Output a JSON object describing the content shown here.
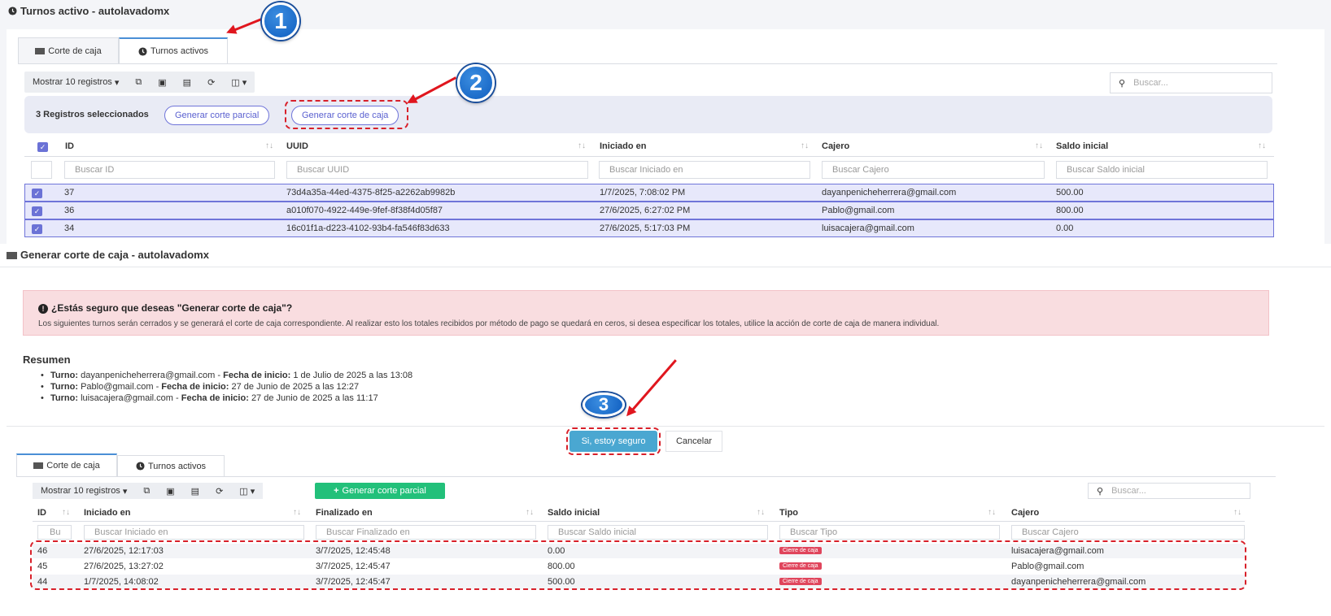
{
  "panel1": {
    "title": "Turnos activo - autolavadomx",
    "tabs": [
      "Corte de caja",
      "Turnos activos"
    ],
    "show_records": "Mostrar 10 registros",
    "search_placeholder": "Buscar...",
    "selected_text": "3 Registros seleccionados",
    "btn_partial": "Generar corte parcial",
    "btn_cut": "Generar corte de caja",
    "columns": [
      "ID",
      "UUID",
      "Iniciado en",
      "Cajero",
      "Saldo inicial"
    ],
    "filters": [
      "Buscar ID",
      "Buscar UUID",
      "Buscar Iniciado en",
      "Buscar Cajero",
      "Buscar Saldo inicial"
    ],
    "rows": [
      [
        "37",
        "73d4a35a-44ed-4375-8f25-a2262ab9982b",
        "1/7/2025, 7:08:02 PM",
        "dayanpenicheherrera@gmail.com",
        "500.00"
      ],
      [
        "36",
        "a010f070-4922-449e-9fef-8f38f4d05f87",
        "27/6/2025, 6:27:02 PM",
        "Pablo@gmail.com",
        "800.00"
      ],
      [
        "34",
        "16c01f1a-d223-4102-93b4-fa546f83d633",
        "27/6/2025, 5:17:03 PM",
        "luisacajera@gmail.com",
        "0.00"
      ]
    ]
  },
  "panel2": {
    "title": "Generar corte de caja - autolavadomx",
    "alert_title": "¿Estás seguro que deseas \"Generar corte de caja\"?",
    "alert_body": "Los siguientes turnos serán cerrados y se generará el corte de caja correspondiente. Al realizar esto los totales recibidos por método de pago se quedará en ceros, si desea especificar los totales, utilice la acción de corte de caja de manera individual.",
    "summary_title": "Resumen",
    "label_turno": "Turno:",
    "label_fecha": "Fecha de inicio:",
    "items": [
      {
        "turno": "dayanpenicheherrera@gmail.com",
        "fecha": "1 de Julio de 2025 a las 13:08"
      },
      {
        "turno": "Pablo@gmail.com",
        "fecha": "27 de Junio de 2025 a las 12:27"
      },
      {
        "turno": "luisacajera@gmail.com",
        "fecha": "27 de Junio de 2025 a las 11:17"
      }
    ],
    "confirm": "Si, estoy seguro",
    "cancel": "Cancelar"
  },
  "panel3": {
    "tabs": [
      "Corte de caja",
      "Turnos activos"
    ],
    "show_records": "Mostrar 10 registros",
    "btn_partial": "Generar corte parcial",
    "search_placeholder": "Buscar...",
    "columns": [
      "ID",
      "Iniciado en",
      "Finalizado en",
      "Saldo inicial",
      "Tipo",
      "Cajero"
    ],
    "filters": [
      "Bu",
      "Buscar Iniciado en",
      "Buscar Finalizado en",
      "Buscar Saldo inicial",
      "Buscar Tipo",
      "Buscar Cajero"
    ],
    "rows": [
      [
        "46",
        "27/6/2025, 12:17:03",
        "3/7/2025, 12:45:48",
        "0.00",
        "Cierre de caja",
        "luisacajera@gmail.com"
      ],
      [
        "45",
        "27/6/2025, 13:27:02",
        "3/7/2025, 12:45:47",
        "800.00",
        "Cierre de caja",
        "Pablo@gmail.com"
      ],
      [
        "44",
        "1/7/2025, 14:08:02",
        "3/7/2025, 12:45:47",
        "500.00",
        "Cierre de caja",
        "dayanpenicheherrera@gmail.com"
      ]
    ]
  },
  "markers": [
    "1",
    "2",
    "3"
  ],
  "colors": {
    "accent": "#6f74d9",
    "danger": "#e0161e",
    "primary": "#4aa7d1",
    "success": "#22c07a"
  }
}
